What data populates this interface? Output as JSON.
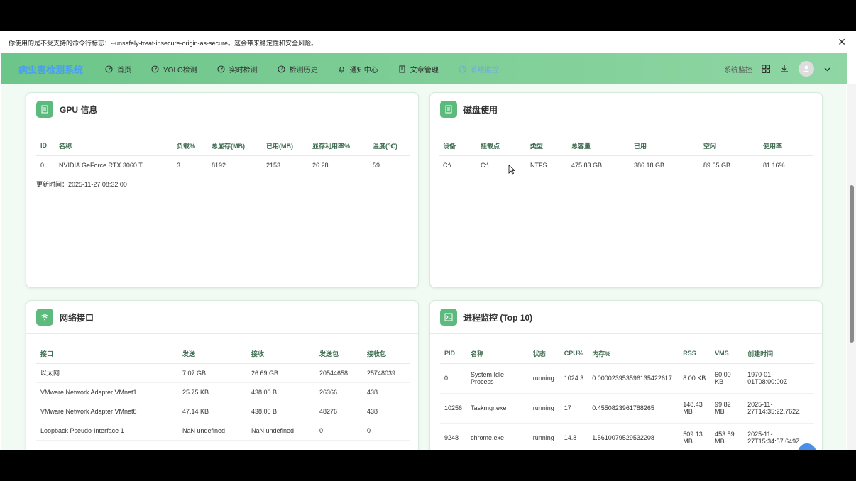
{
  "infobar": {
    "message": "你使用的是不受支持的命令行标志：--unsafely-treat-insecure-origin-as-secure。这会带来稳定性和安全风险。"
  },
  "nav": {
    "logo": "病虫害检测系统",
    "items": [
      {
        "label": "首页",
        "icon": "dashboard-icon"
      },
      {
        "label": "YOLO检测",
        "icon": "dashboard-icon"
      },
      {
        "label": "实时检测",
        "icon": "dashboard-icon"
      },
      {
        "label": "检测历史",
        "icon": "dashboard-icon"
      },
      {
        "label": "通知中心",
        "icon": "bell-icon"
      },
      {
        "label": "文章管理",
        "icon": "document-icon"
      },
      {
        "label": "系统监控",
        "icon": "monitor-icon",
        "active": true
      }
    ],
    "right_label": "系统监控"
  },
  "gpu": {
    "title": "GPU 信息",
    "headers": [
      "ID",
      "名称",
      "负载%",
      "总显存(MB)",
      "已用(MB)",
      "显存利用率%",
      "温度(℃)"
    ],
    "rows": [
      [
        "0",
        "NVIDIA GeForce RTX 3060 Ti",
        "3",
        "8192",
        "2153",
        "26.28",
        "59"
      ]
    ],
    "updated": "更新时间：2025-11-27 08:32:00"
  },
  "disk": {
    "title": "磁盘使用",
    "headers": [
      "设备",
      "挂载点",
      "类型",
      "总容量",
      "已用",
      "空闲",
      "使用率"
    ],
    "rows": [
      [
        "C:\\",
        "C:\\",
        "NTFS",
        "475.83 GB",
        "386.18 GB",
        "89.65 GB",
        "81.16%"
      ]
    ]
  },
  "network": {
    "title": "网络接口",
    "headers": [
      "接口",
      "发送",
      "接收",
      "发送包",
      "接收包"
    ],
    "rows": [
      [
        "以太网",
        "7.07 GB",
        "26.69 GB",
        "20544658",
        "25748039"
      ],
      [
        "VMware Network Adapter VMnet1",
        "25.75 KB",
        "438.00 B",
        "26366",
        "438"
      ],
      [
        "VMware Network Adapter VMnet8",
        "47.14 KB",
        "438.00 B",
        "48276",
        "438"
      ],
      [
        "Loopback Pseudo-Interface 1",
        "NaN undefined",
        "NaN undefined",
        "0",
        "0"
      ]
    ]
  },
  "process": {
    "title": "进程监控 (Top 10)",
    "headers": [
      "PID",
      "名称",
      "状态",
      "CPU%",
      "内存%",
      "RSS",
      "VMS",
      "创建时间"
    ],
    "rows": [
      [
        "0",
        "System Idle Process",
        "running",
        "1024.3",
        "0.000023953596135422617",
        "8.00 KB",
        "60.00 KB",
        "1970-01-01T08:00:00Z"
      ],
      [
        "10256",
        "Taskmgr.exe",
        "running",
        "17",
        "0.4550823961788265",
        "148.43 MB",
        "99.82 MB",
        "2025-11-27T14:35:22.762Z"
      ],
      [
        "9248",
        "chrome.exe",
        "running",
        "14.8",
        "1.5610079529532208",
        "509.13 MB",
        "453.59 MB",
        "2025-11-27T15:34:57.649Z"
      ]
    ]
  },
  "colors": {
    "accent": "#5cba7c",
    "nav_bg": "#7ccd96",
    "active": "#6aa8e8"
  }
}
